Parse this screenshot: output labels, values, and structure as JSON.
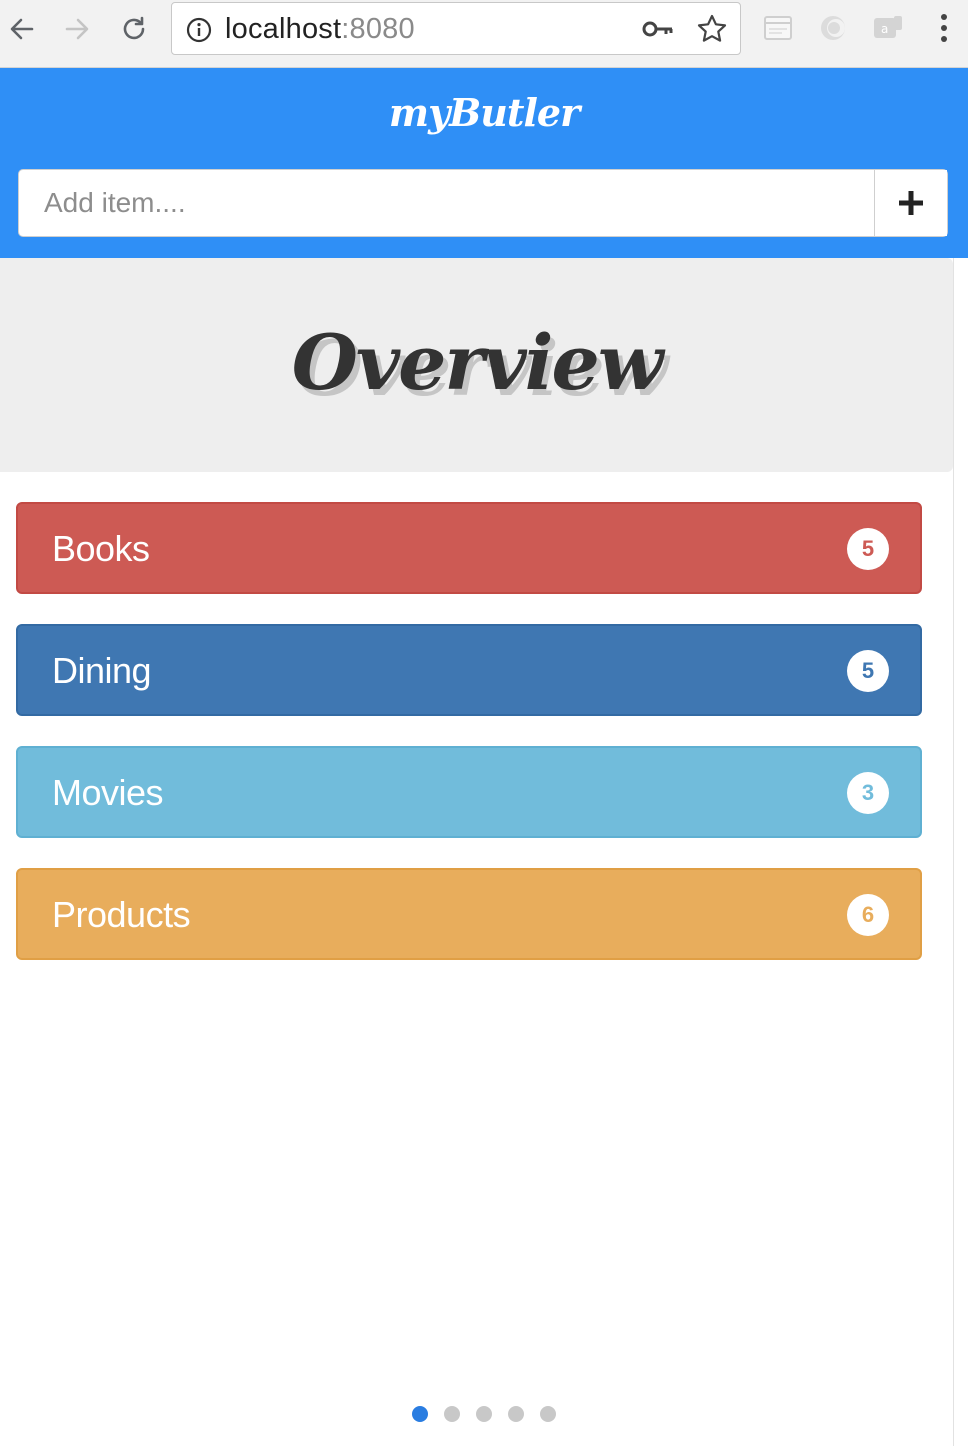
{
  "browser": {
    "url_host": "localhost",
    "url_port": ":8080"
  },
  "app": {
    "brand": "myButler",
    "add_placeholder": "Add item....",
    "add_button_icon": "plus-icon",
    "page_title": "Overview"
  },
  "categories": [
    {
      "label": "Books",
      "count": "5",
      "color": "#cd5a54",
      "border": "#c24a44"
    },
    {
      "label": "Dining",
      "count": "5",
      "color": "#3f77b2",
      "border": "#336aa3"
    },
    {
      "label": "Movies",
      "count": "3",
      "color": "#71bcdb",
      "border": "#5fb0d2"
    },
    {
      "label": "Products",
      "count": "6",
      "color": "#e8ad5c",
      "border": "#e09f45"
    }
  ],
  "pager": {
    "pages": 5,
    "active_index": 0
  },
  "colors": {
    "header": "#2f8ff6",
    "jumbotron": "#eeeeee",
    "active_dot": "#2a7de1",
    "inactive_dot": "#c8c8c8"
  }
}
